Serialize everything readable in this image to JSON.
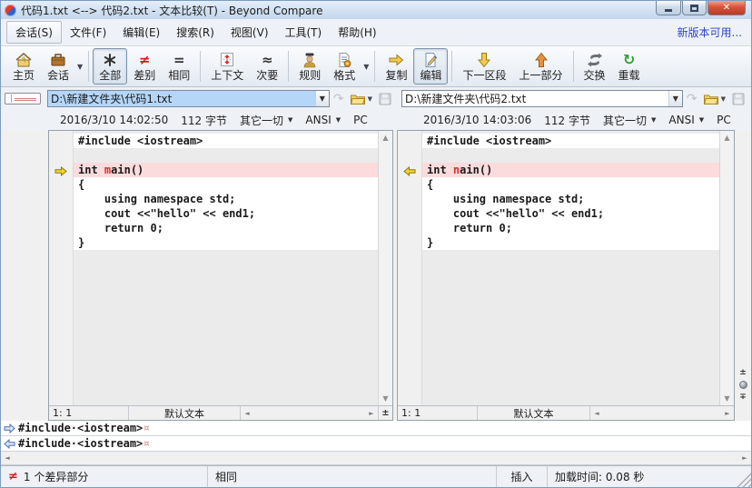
{
  "window": {
    "title": "代码1.txt <--> 代码2.txt - 文本比较(T) - Beyond Compare",
    "update_link": "新版本可用..."
  },
  "menu": {
    "items": [
      "会话(S)",
      "文件(F)",
      "编辑(E)",
      "搜索(R)",
      "视图(V)",
      "工具(T)",
      "帮助(H)"
    ]
  },
  "toolbar": {
    "home": "主页",
    "session": "会话",
    "all": "全部",
    "differences": "差别",
    "same": "相同",
    "context": "上下文",
    "minor": "次要",
    "rules": "规则",
    "format": "格式",
    "copy": "复制",
    "edit": "编辑",
    "next_section": "下一区段",
    "prev_part": "上一部分",
    "swap": "交换",
    "reload": "重载"
  },
  "left_file": {
    "path": "D:\\新建文件夹\\代码1.txt",
    "modified": "2016/3/10 14:02:50",
    "size": "112 字节",
    "scope": "其它一切",
    "encoding": "ANSI",
    "format": "PC",
    "cursor": "1: 1",
    "syntax": "默认文本"
  },
  "right_file": {
    "path": "D:\\新建文件夹\\代码2.txt",
    "modified": "2016/3/10 14:03:06",
    "size": "112 字节",
    "scope": "其它一切",
    "encoding": "ANSI",
    "format": "PC",
    "cursor": "1: 1",
    "syntax": "默认文本"
  },
  "code": {
    "left": {
      "l1": "#include <iostream>",
      "l3_pre": "int ",
      "l3_red": "m",
      "l3_post": "ain()",
      "l4": "{",
      "l5": "    using namespace std;",
      "l6": "    cout <<\"hello\" << end1;",
      "l7": "    return 0;",
      "l8": "}"
    },
    "right": {
      "l1": "#include <iostream>",
      "l3_pre": "int ",
      "l3_red": "n",
      "l3_post": "ain()",
      "l4": "{",
      "l5": "    using namespace std;",
      "l6": "    cout <<\"hello\" << end1;",
      "l7": "    return 0;",
      "l8": "}"
    }
  },
  "detail": {
    "row1": "#include·<iostream>",
    "row2": "#include·<iostream>",
    "eol": "¤"
  },
  "statusbar": {
    "diff_icon": "≠",
    "diff": "1 个差异部分",
    "same": "相同",
    "mode": "插入",
    "load_time": "加载时间: 0.08 秒"
  },
  "colors": {
    "diff_line_bg": "#fbdbdc",
    "diff_char": "#d43030",
    "selection_bg": "#b5d6f7",
    "link_blue": "#2b45c0",
    "status_red": "#cc2222"
  }
}
